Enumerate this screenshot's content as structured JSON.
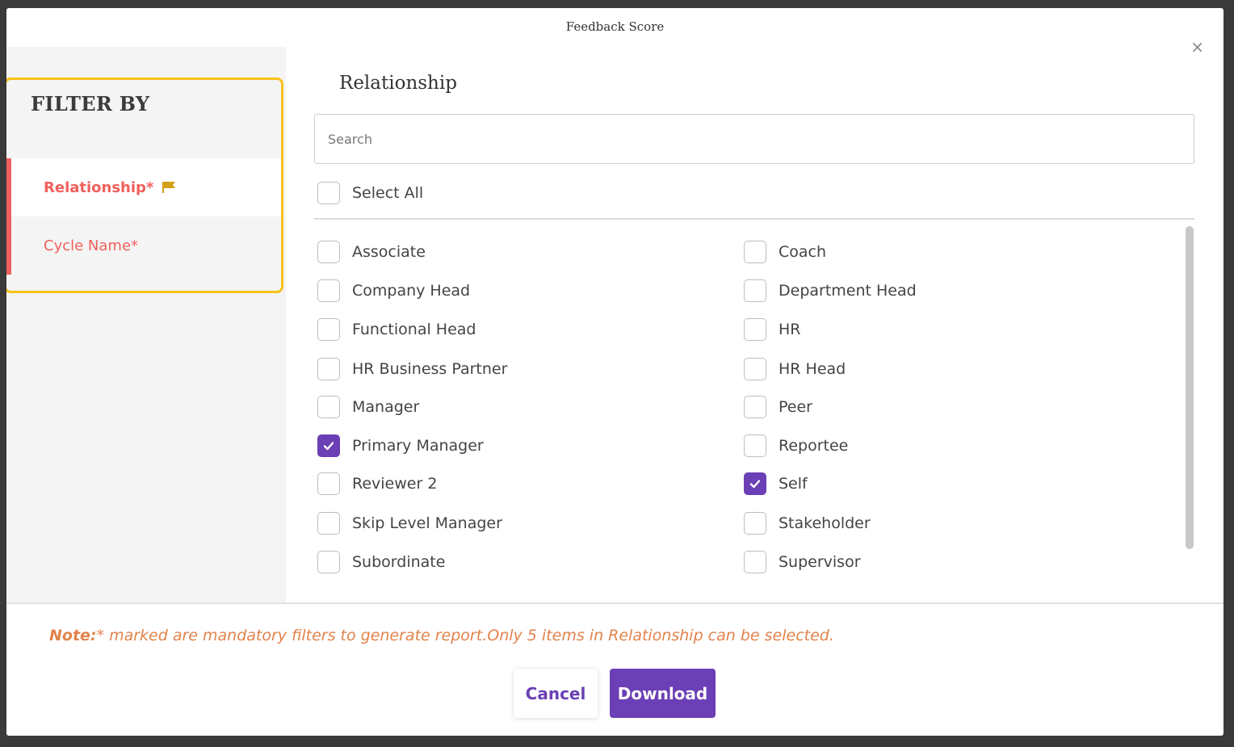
{
  "modal": {
    "title": "Feedback Score",
    "close_label": "×"
  },
  "sidebar": {
    "title": "FILTER BY",
    "items": [
      {
        "label": "Relationship*",
        "active": true,
        "icon": "flag-icon"
      },
      {
        "label": "Cycle Name*",
        "active": false
      }
    ]
  },
  "relationship": {
    "title": "Relationship",
    "search_placeholder": "Search",
    "select_all": "Select All",
    "options_left": [
      {
        "label": "Associate",
        "checked": false
      },
      {
        "label": "Company Head",
        "checked": false
      },
      {
        "label": "Functional Head",
        "checked": false
      },
      {
        "label": "HR Business Partner",
        "checked": false
      },
      {
        "label": "Manager",
        "checked": false
      },
      {
        "label": "Primary Manager",
        "checked": true
      },
      {
        "label": "Reviewer 2",
        "checked": false
      },
      {
        "label": "Skip Level Manager",
        "checked": false
      },
      {
        "label": "Subordinate",
        "checked": false
      }
    ],
    "options_right": [
      {
        "label": "Coach",
        "checked": false
      },
      {
        "label": "Department Head",
        "checked": false
      },
      {
        "label": "HR",
        "checked": false
      },
      {
        "label": "HR Head",
        "checked": false
      },
      {
        "label": "Peer",
        "checked": false
      },
      {
        "label": "Reportee",
        "checked": false
      },
      {
        "label": "Self",
        "checked": true
      },
      {
        "label": "Stakeholder",
        "checked": false
      },
      {
        "label": "Supervisor",
        "checked": false
      }
    ]
  },
  "footer": {
    "note_prefix": "Note:",
    "note_text": "* marked are mandatory filters to generate report.Only 5 items in Relationship can be selected.",
    "cancel_label": "Cancel",
    "download_label": "Download"
  },
  "colors": {
    "accent": "#6b3fb5",
    "required": "#f0605d",
    "highlight": "#f7c21b",
    "note": "#e2834b"
  }
}
